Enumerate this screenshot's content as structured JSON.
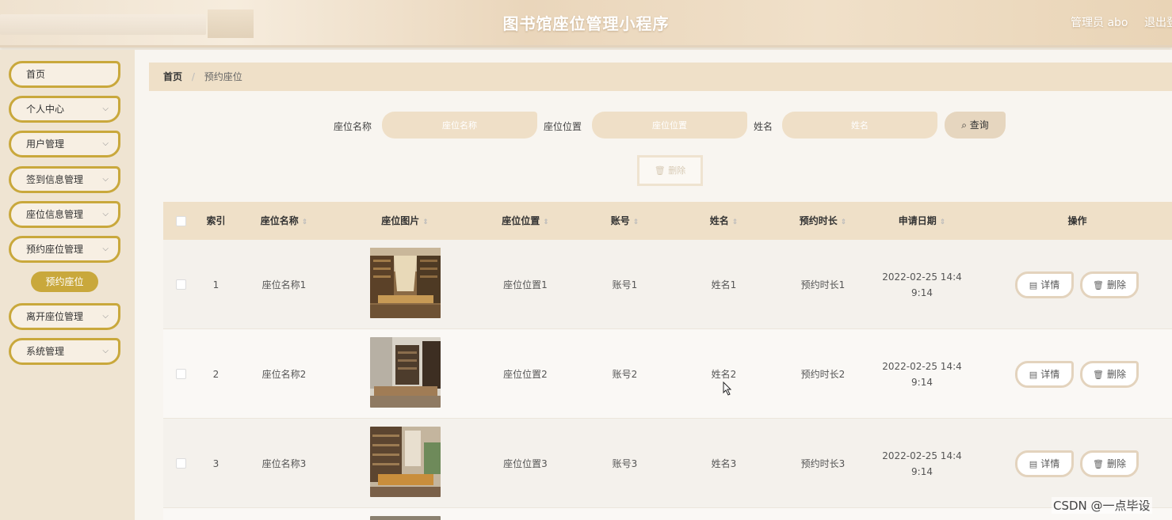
{
  "header": {
    "title": "图书馆座位管理小程序",
    "admin": "管理员 abo",
    "logout": "退出登"
  },
  "sidebar": {
    "items": [
      {
        "label": "首页",
        "expandable": false
      },
      {
        "label": "个人中心",
        "expandable": true
      },
      {
        "label": "用户管理",
        "expandable": true
      },
      {
        "label": "签到信息管理",
        "expandable": true
      },
      {
        "label": "座位信息管理",
        "expandable": true
      },
      {
        "label": "预约座位管理",
        "expandable": true
      },
      {
        "label": "离开座位管理",
        "expandable": true
      },
      {
        "label": "系统管理",
        "expandable": true
      }
    ],
    "active_sub": "预约座位"
  },
  "breadcrumb": {
    "home": "首页",
    "sep": "/",
    "current": "预约座位"
  },
  "search": {
    "seat_name_label": "座位名称",
    "seat_name_placeholder": "座位名称",
    "seat_loc_label": "座位位置",
    "seat_loc_placeholder": "座位位置",
    "name_label": "姓名",
    "name_placeholder": "姓名",
    "query_label": "查询"
  },
  "toolbar": {
    "delete_label": "删除"
  },
  "table": {
    "headers": {
      "index": "索引",
      "seat_name": "座位名称",
      "seat_img": "座位图片",
      "seat_loc": "座位位置",
      "account": "账号",
      "name": "姓名",
      "duration": "预约时长",
      "date": "申请日期",
      "ops": "操作"
    },
    "rows": [
      {
        "index": "1",
        "seat_name": "座位名称1",
        "seat_loc": "座位位置1",
        "account": "账号1",
        "name": "姓名1",
        "duration": "预约时长1",
        "date1": "2022-02-25 14:4",
        "date2": "9:14"
      },
      {
        "index": "2",
        "seat_name": "座位名称2",
        "seat_loc": "座位位置2",
        "account": "账号2",
        "name": "姓名2",
        "duration": "预约时长2",
        "date1": "2022-02-25 14:4",
        "date2": "9:14"
      },
      {
        "index": "3",
        "seat_name": "座位名称3",
        "seat_loc": "座位位置3",
        "account": "账号3",
        "name": "姓名3",
        "duration": "预约时长3",
        "date1": "2022-02-25 14:4",
        "date2": "9:14"
      }
    ],
    "detail_label": "详情",
    "delete_label": "删除"
  },
  "watermark": "CSDN @一点毕设",
  "colors": {
    "accent": "#c9a83c",
    "header_bg": "#efe0c8"
  }
}
